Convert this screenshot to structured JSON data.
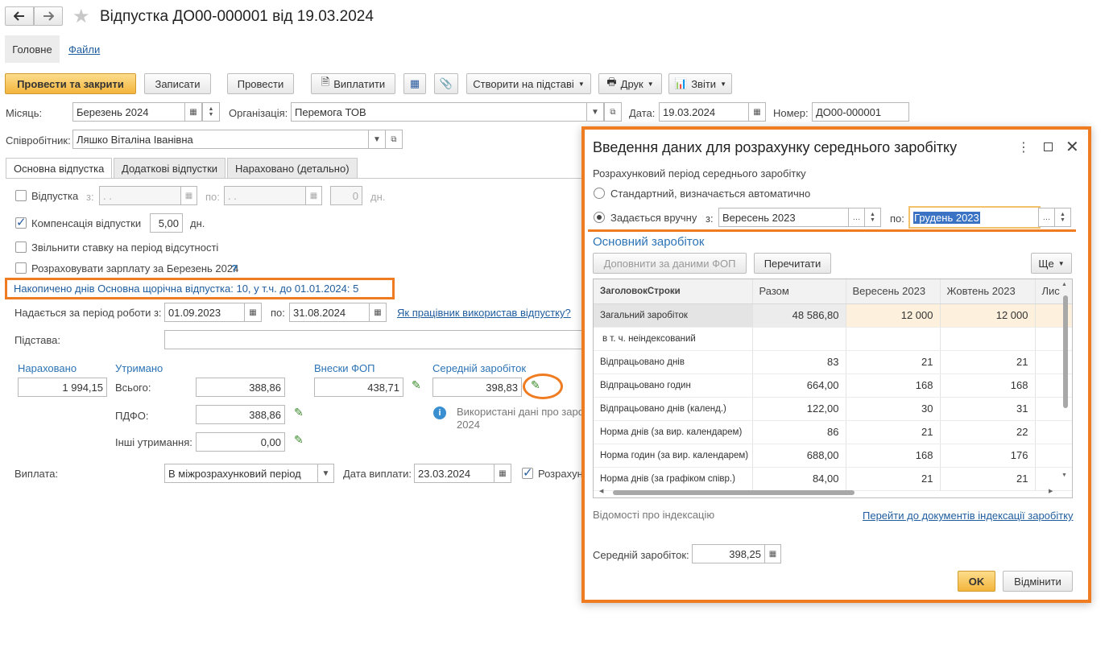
{
  "window": {
    "title": "Відпустка ДО00-000001 від 19.03.2024"
  },
  "nav": {
    "main": "Головне",
    "files": "Файли"
  },
  "toolbar": {
    "post_close": "Провести та закрити",
    "save": "Записати",
    "post": "Провести",
    "pay": "Виплатити",
    "create_based": "Створити на підставі",
    "print": "Друк",
    "reports": "Звіти"
  },
  "header": {
    "month_label": "Місяць:",
    "month": "Березень 2024",
    "org_label": "Організація:",
    "org": "Перемога ТОВ",
    "date_label": "Дата:",
    "date": "19.03.2024",
    "number_label": "Номер:",
    "number": "ДО00-000001",
    "employee_label": "Співробітник:",
    "employee": "Ляшко Віталіна Іванівна"
  },
  "tabs": [
    "Основна відпустка",
    "Додаткові відпустки",
    "Нараховано (детально)"
  ],
  "main": {
    "vacation_label": "Відпустка",
    "from_label": "з:",
    "date_placeholder": " .  .",
    "to_label": "по:",
    "days": "0",
    "days_unit": "дн.",
    "compensation_label": "Компенсація відпустки",
    "compensation_days": "5,00",
    "compensation_unit": "дн.",
    "release_rate": "Звільнити ставку на період відсутності",
    "calc_salary": "Розраховувати зарплату за Березень 2024",
    "help": "?",
    "accumulated": "Накопичено днів Основна щорічна відпустка: 10, у т.ч. до 01.01.2024: 5",
    "period_label": "Надається за період роботи з:",
    "period_from": "01.09.2023",
    "period_to_label": "по:",
    "period_to": "31.08.2024",
    "used_link": "Як працівник використав відпустку?",
    "basis_label": "Підстава:",
    "accrued_label": "Нараховано",
    "accrued": "1 994,15",
    "withheld_label": "Утримано",
    "total_label": "Всього:",
    "total": "388,86",
    "pdfo_label": "ПДФО:",
    "pdfo": "388,86",
    "other_label": "Інші утримання:",
    "other": "0,00",
    "fop_label": "Внески ФОП",
    "fop": "438,71",
    "avg_label": "Середній заробіток",
    "avg": "398,83",
    "info_text": "Використані дані про заро",
    "info_text2": "2024",
    "payout_label": "Виплата:",
    "payout": "В міжрозрахунковий період",
    "payout_date_label": "Дата виплати:",
    "payout_date": "23.03.2024",
    "calc_cut": "Розрахун"
  },
  "dialog": {
    "title": "Введення даних для розрахунку середнього заробітку",
    "period_heading": "Розрахунковий період середнього заробітку",
    "standard": "Стандартний, визначається автоматично",
    "manual": "Задається вручну",
    "from_label": "з:",
    "from": "Вересень 2023",
    "to_label": "по:",
    "to": "Грудень 2023",
    "section": "Основний заробіток",
    "fill_fop": "Доповнити за даними ФОП",
    "reread": "Перечитати",
    "more": "Ще",
    "columns": [
      "ЗаголовокСтроки",
      "Разом",
      "Вересень 2023",
      "Жовтень 2023",
      "Лис"
    ],
    "rows": [
      [
        "Загальний заробіток",
        "48 586,80",
        "12 000",
        "12 000"
      ],
      [
        "в т. ч. неіндексований",
        "",
        "",
        ""
      ],
      [
        "Відпрацьовано днів",
        "83",
        "21",
        "21"
      ],
      [
        "Відпрацьовано годин",
        "664,00",
        "168",
        "168"
      ],
      [
        "Відпрацьовано днів (календ.)",
        "122,00",
        "30",
        "31"
      ],
      [
        "Норма днів (за вир. календарем)",
        "86",
        "21",
        "22"
      ],
      [
        "Норма годин (за вир. календарем)",
        "688,00",
        "168",
        "176"
      ],
      [
        "Норма днів (за графіком співр.)",
        "84,00",
        "21",
        "21"
      ]
    ],
    "indexation_label": "Відомості про індексацію",
    "indexation_link": "Перейти до документів індексації заробітку",
    "avg_label": "Середній заробіток:",
    "avg": "398,25",
    "ok": "OK",
    "cancel": "Відмінити"
  },
  "colors": {
    "accent": "#f07c21",
    "primary_button": "#f3b53d",
    "link": "#1f5d9e"
  }
}
